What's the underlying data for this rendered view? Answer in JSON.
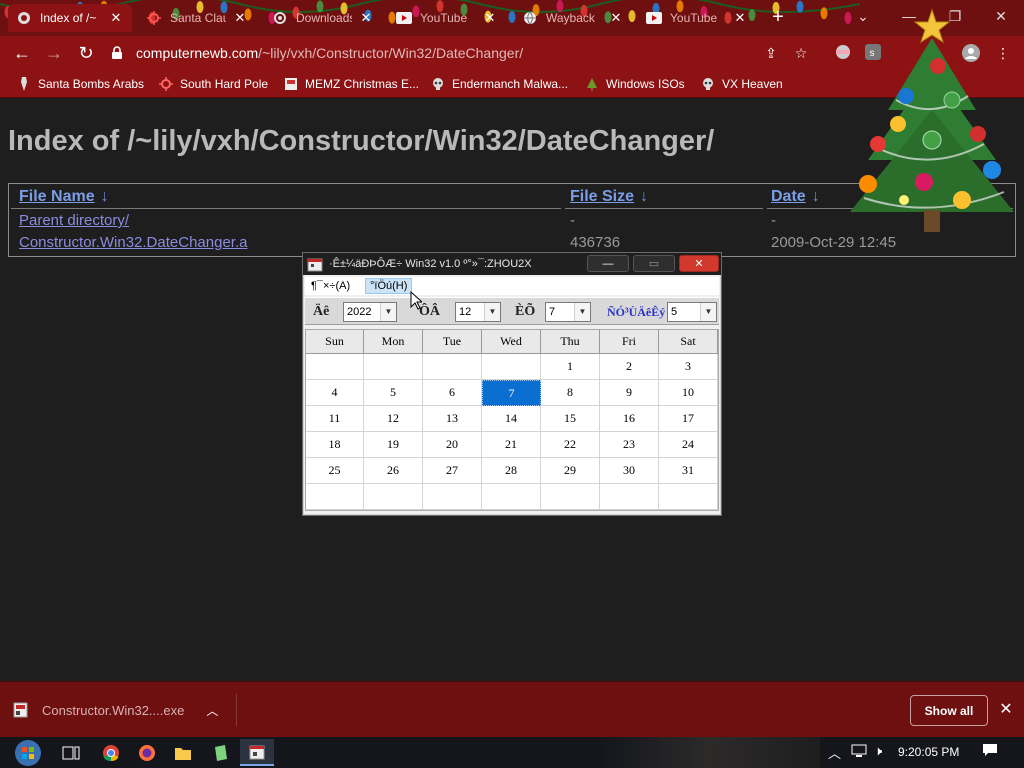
{
  "browser": {
    "tabs": [
      {
        "title": "Index of /~",
        "icon": "page-icon",
        "active": true
      },
      {
        "title": "Santa Clau",
        "icon": "virus-icon"
      },
      {
        "title": "Downloads",
        "icon": "gear-icon"
      },
      {
        "title": "YouTube",
        "icon": "youtube-icon"
      },
      {
        "title": "Wayback",
        "icon": "globe-icon"
      },
      {
        "title": "YouTube",
        "icon": "youtube-icon"
      }
    ],
    "new_tab_symbol": "+",
    "url_host": "computernewb.com",
    "url_path": "/~lily/vxh/Constructor/Win32/DateChanger/",
    "bookmarks": [
      {
        "label": "Santa Bombs Arabs",
        "icon": "trojan-icon"
      },
      {
        "label": "South Hard Pole",
        "icon": "virus-icon"
      },
      {
        "label": "MEMZ Christmas E...",
        "icon": "exe-icon"
      },
      {
        "label": "Endermanch Malwa...",
        "icon": "skull-icon"
      },
      {
        "label": "Windows ISOs",
        "icon": "tree-icon"
      },
      {
        "label": "VX Heaven",
        "icon": "skull-icon"
      }
    ]
  },
  "page": {
    "heading": "Index of /~lily/vxh/Constructor/Win32/DateChanger/",
    "columns": {
      "name": "File Name",
      "size": "File Size",
      "date": "Date",
      "sort_arrow": "↓"
    },
    "rows": [
      {
        "name": "Parent directory/",
        "size": "-",
        "date": "-"
      },
      {
        "name": "Constructor.Win32.DateChanger.a",
        "size": "436736",
        "date": "2009-Oct-29 12:45"
      }
    ]
  },
  "dialog": {
    "title": "·Ê±¼äÐÞÔÆ÷ Win32 v1.0  º°»¯:ZHOU2X",
    "menu": [
      "¶¯×÷(A)",
      "°ïÖú(H)"
    ],
    "year_label": "Äê",
    "year_value": "2022",
    "month_label": "ÔÂ",
    "month_value": "12",
    "day_label": "ÈÕ",
    "day_value": "7",
    "weekday_label": "ÑÓ³ÙÄêÊý",
    "weekday_value": "5",
    "weekdays": [
      "Sun",
      "Mon",
      "Tue",
      "Wed",
      "Thu",
      "Fri",
      "Sat"
    ],
    "weeks": [
      [
        "",
        "",
        "",
        "",
        "1",
        "2",
        "3"
      ],
      [
        "4",
        "5",
        "6",
        "7",
        "8",
        "9",
        "10"
      ],
      [
        "11",
        "12",
        "13",
        "14",
        "15",
        "16",
        "17"
      ],
      [
        "18",
        "19",
        "20",
        "21",
        "22",
        "23",
        "24"
      ],
      [
        "25",
        "26",
        "27",
        "28",
        "29",
        "30",
        "31"
      ],
      [
        "",
        "",
        "",
        "",
        "",
        "",
        ""
      ]
    ],
    "selected_day": "7",
    "accent": "#0a6fd0"
  },
  "downloads": {
    "file": "Constructor.Win32....exe",
    "show_all": "Show all"
  },
  "taskbar": {
    "clock": "9:20:05 PM",
    "apps": [
      "ie-icon",
      "taskview-icon",
      "chrome-icon",
      "firefox-icon",
      "folder-icon",
      "notepad-icon",
      "datechanger-icon"
    ]
  },
  "colors": {
    "chrome_dark": "#6e0f10",
    "chrome": "#8c1214",
    "link": "#7b9ee6",
    "page_bg": "#1e1e1e"
  }
}
